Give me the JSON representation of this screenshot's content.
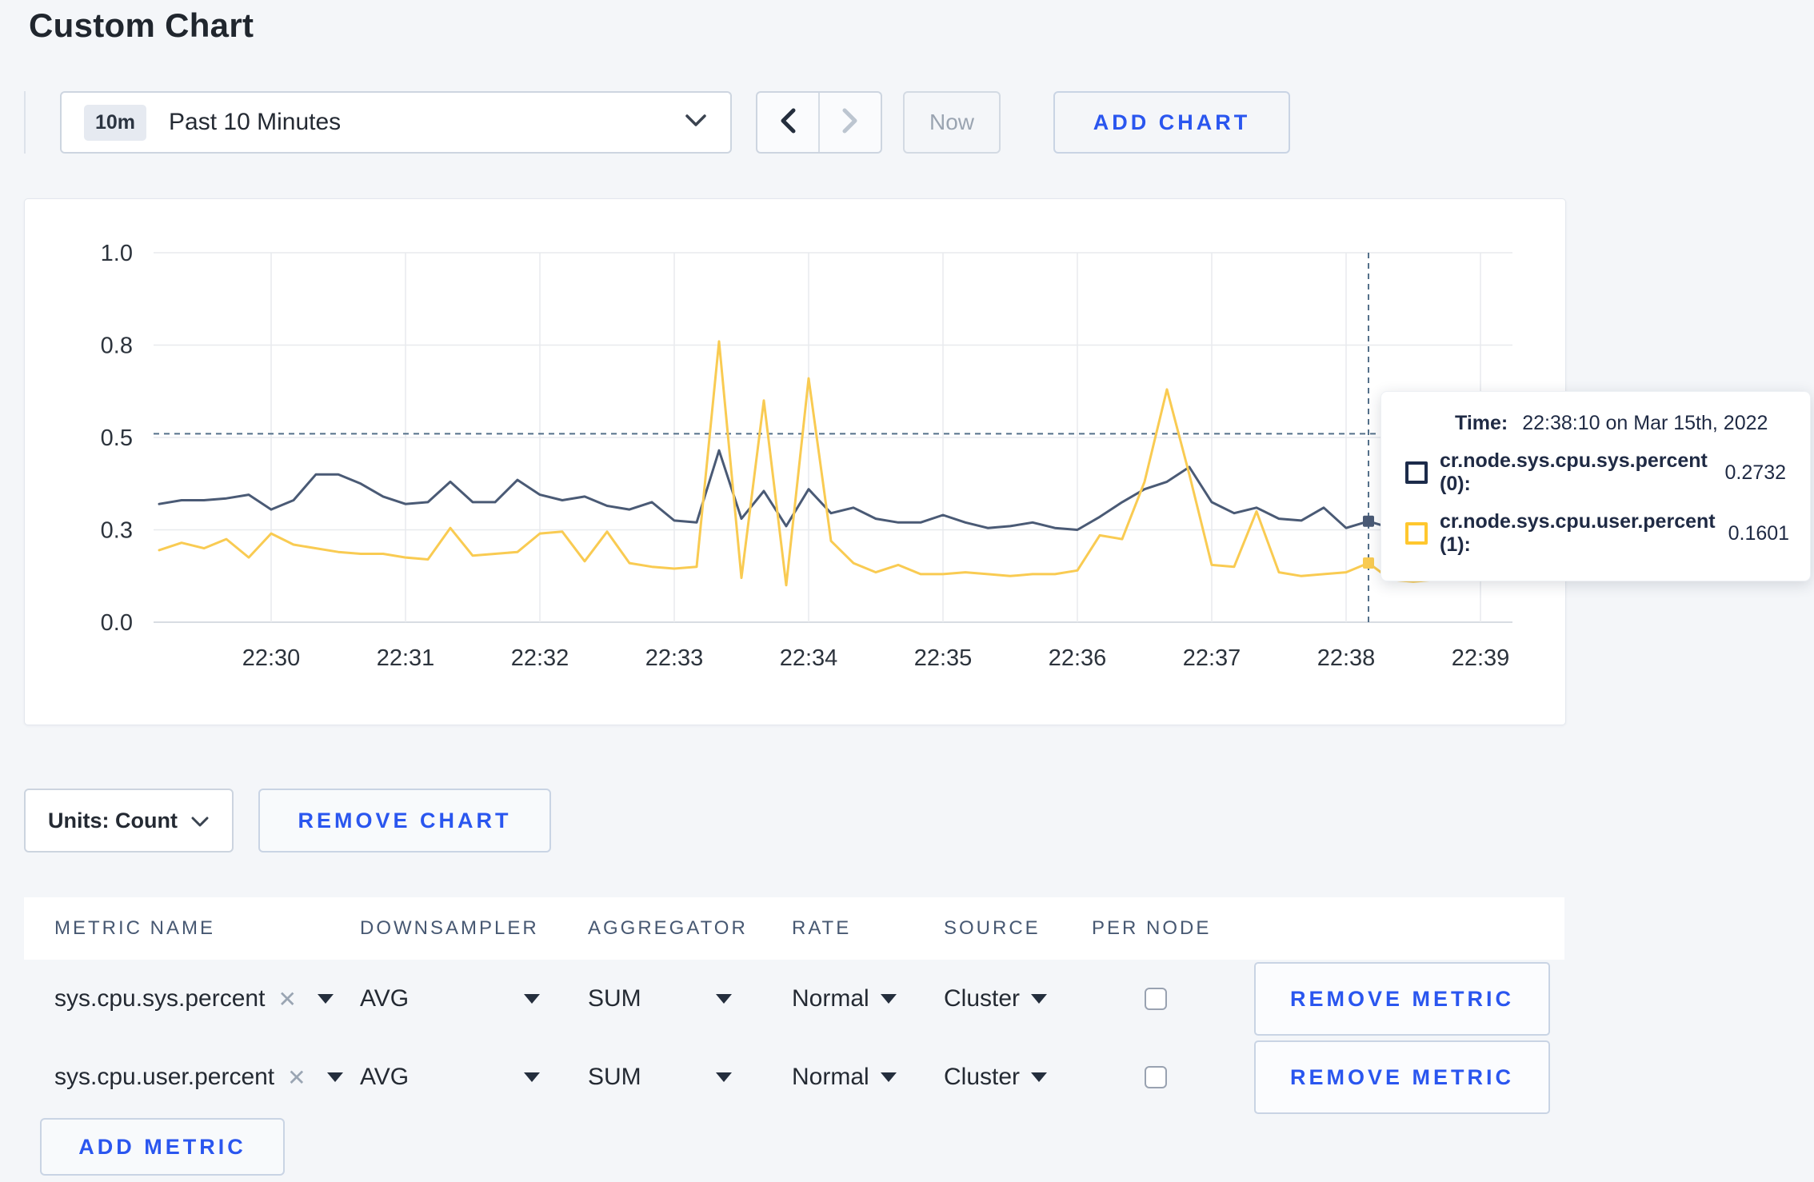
{
  "page": {
    "title": "Custom Chart"
  },
  "colors": {
    "accent": "#2a56ef",
    "page_background": "#f4f6f9",
    "series_sys": "#4a5a75",
    "series_user": "#f9cb52"
  },
  "icons": {
    "close": "✕"
  },
  "toolbar": {
    "time_range": {
      "badge": "10m",
      "label": "Past 10 Minutes"
    },
    "now_label": "Now",
    "add_chart_label": "ADD CHART"
  },
  "chart_controls": {
    "units_label": "Units: Count",
    "remove_chart_label": "REMOVE CHART"
  },
  "chart_data": {
    "type": "line",
    "title": "",
    "xlabel": "",
    "ylabel": "",
    "ylim": [
      0,
      1
    ],
    "grid": true,
    "x_ticks": [
      "22:30",
      "22:31",
      "22:32",
      "22:33",
      "22:34",
      "22:35",
      "22:36",
      "22:37",
      "22:38",
      "22:39"
    ],
    "x_step_seconds": 10,
    "x_start_offset_steps": -5,
    "y_ticks": [
      {
        "value": 0,
        "label": "0.0"
      },
      {
        "value": 0.25,
        "label": "0.3"
      },
      {
        "value": 0.5,
        "label": "0.5"
      },
      {
        "value": 0.75,
        "label": "0.8"
      },
      {
        "value": 1,
        "label": "1.0"
      }
    ],
    "series": [
      {
        "name": "cr.node.sys.cpu.sys.percent",
        "color": "#4a5a75",
        "values": [
          0.32,
          0.33,
          0.33,
          0.335,
          0.345,
          0.305,
          0.33,
          0.4,
          0.4,
          0.375,
          0.34,
          0.32,
          0.325,
          0.38,
          0.325,
          0.325,
          0.385,
          0.345,
          0.33,
          0.34,
          0.315,
          0.305,
          0.325,
          0.275,
          0.27,
          0.465,
          0.28,
          0.355,
          0.26,
          0.36,
          0.295,
          0.31,
          0.28,
          0.27,
          0.27,
          0.29,
          0.27,
          0.255,
          0.26,
          0.27,
          0.255,
          0.25,
          0.285,
          0.325,
          0.36,
          0.38,
          0.42,
          0.325,
          0.295,
          0.31,
          0.28,
          0.275,
          0.31,
          0.255,
          0.2732,
          0.255,
          0.265,
          0.275,
          0.275,
          0.285,
          0.295
        ]
      },
      {
        "name": "cr.node.sys.cpu.user.percent",
        "color": "#f9cb52",
        "values": [
          0.195,
          0.215,
          0.2,
          0.225,
          0.175,
          0.24,
          0.21,
          0.2,
          0.19,
          0.185,
          0.185,
          0.175,
          0.17,
          0.255,
          0.18,
          0.185,
          0.19,
          0.24,
          0.245,
          0.165,
          0.245,
          0.16,
          0.15,
          0.145,
          0.15,
          0.76,
          0.12,
          0.6,
          0.1,
          0.66,
          0.22,
          0.16,
          0.135,
          0.155,
          0.13,
          0.13,
          0.135,
          0.13,
          0.125,
          0.13,
          0.13,
          0.14,
          0.235,
          0.225,
          0.38,
          0.63,
          0.4,
          0.155,
          0.15,
          0.3,
          0.135,
          0.125,
          0.13,
          0.135,
          0.1601,
          0.115,
          0.11,
          0.115,
          0.235,
          0.255,
          0.19
        ]
      }
    ],
    "crosshair": {
      "index": 54,
      "hline_value": 0.51,
      "time": "22:38:10"
    },
    "tooltip": {
      "time_label": "Time:",
      "time_value": "22:38:10 on Mar 15th, 2022",
      "rows": [
        {
          "swatch_color": "#1c2b4a",
          "label": "cr.node.sys.cpu.sys.percent (0):",
          "value": "0.2732"
        },
        {
          "swatch_color": "#ffc72e",
          "label": "cr.node.sys.cpu.user.percent (1):",
          "value": "0.1601"
        }
      ]
    },
    "legend_position": "none"
  },
  "metrics_table": {
    "headers": [
      "METRIC NAME",
      "DOWNSAMPLER",
      "AGGREGATOR",
      "RATE",
      "SOURCE",
      "PER NODE"
    ],
    "rows": [
      {
        "metric": "sys.cpu.sys.percent",
        "downsampler": "AVG",
        "aggregator": "SUM",
        "rate": "Normal",
        "source": "Cluster",
        "per_node_checked": false
      },
      {
        "metric": "sys.cpu.user.percent",
        "downsampler": "AVG",
        "aggregator": "SUM",
        "rate": "Normal",
        "source": "Cluster",
        "per_node_checked": false
      }
    ],
    "remove_metric_label": "REMOVE METRIC",
    "add_metric_label": "ADD METRIC"
  }
}
